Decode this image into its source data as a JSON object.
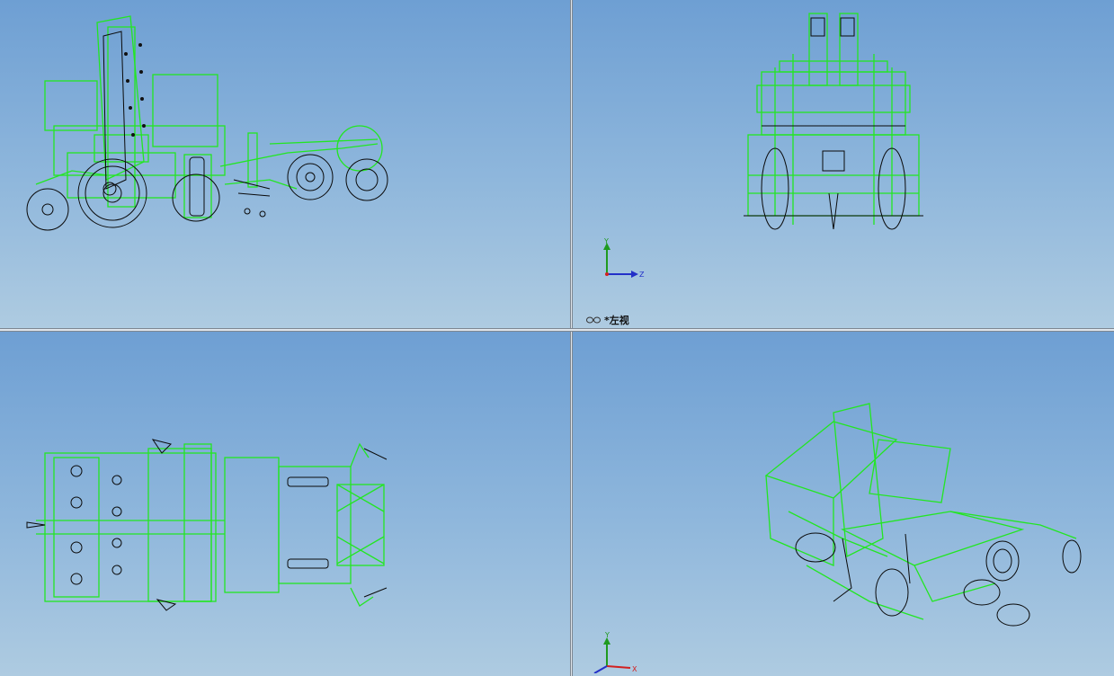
{
  "window": {
    "title": ""
  },
  "viewports": [
    {
      "name": "side-view",
      "label": ""
    },
    {
      "name": "left-view",
      "label": "*左视"
    },
    {
      "name": "top-view",
      "label": ""
    },
    {
      "name": "isometric-view",
      "label": ""
    }
  ],
  "triad": {
    "axis_y": "Y",
    "axis_z": "Z",
    "axis_x": "X"
  },
  "colors": {
    "wireframe": "#22e622",
    "edges": "#0a0a0a",
    "bg_top": "#6e9fd3",
    "bg_bottom": "#aecbe1",
    "axis_y": "#1f9a1f",
    "axis_z": "#2330c8",
    "axis_x": "#d22020"
  },
  "icons": {
    "view_glasses": "glasses-icon"
  }
}
